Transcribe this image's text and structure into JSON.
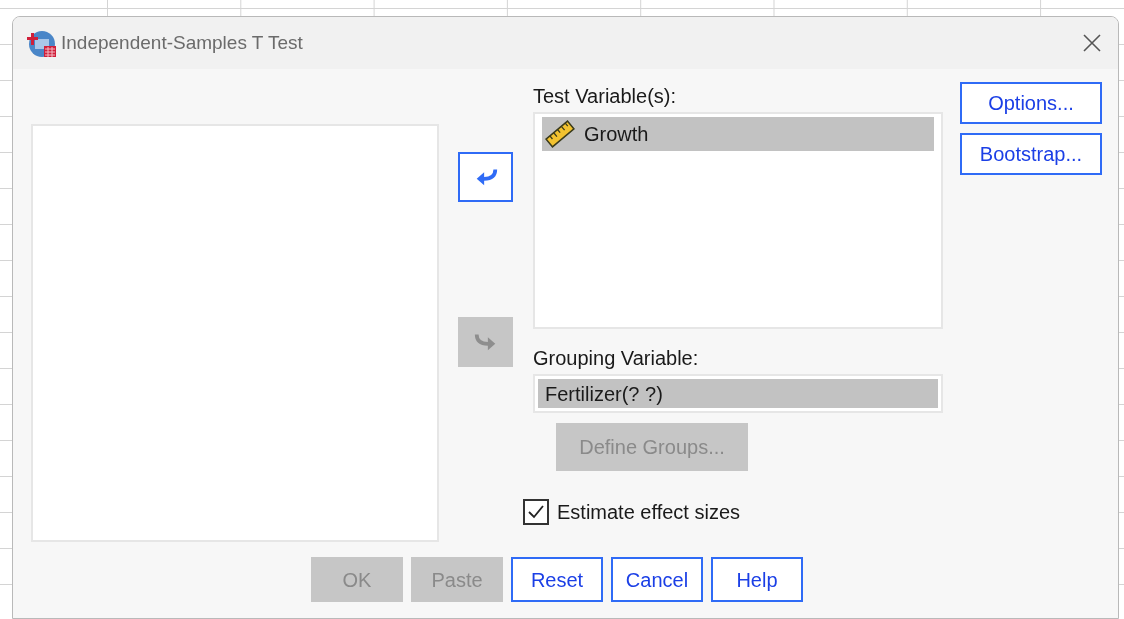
{
  "window": {
    "title": "Independent-Samples T Test"
  },
  "test_move_button": {
    "kind": "back",
    "disabled": false
  },
  "test_variables": {
    "label": "Test Variable(s):",
    "items": [
      {
        "name": "Growth",
        "selected": true
      }
    ]
  },
  "side_buttons": [
    {
      "label": "Options...",
      "disabled": false
    },
    {
      "label": "Bootstrap...",
      "disabled": false
    }
  ],
  "grouping_move_button": {
    "kind": "forward",
    "disabled": true
  },
  "grouping_variable": {
    "label": "Grouping Variable:",
    "value": "Fertilizer(? ?)",
    "selected": true
  },
  "define_groups_button": {
    "label": "Define Groups...",
    "disabled": true
  },
  "estimate_effect_sizes": {
    "label": "Estimate effect sizes",
    "checked": true
  },
  "buttons": [
    {
      "label": "OK",
      "disabled": true
    },
    {
      "label": "Paste",
      "disabled": true
    },
    {
      "label": "Reset",
      "disabled": false
    },
    {
      "label": "Cancel",
      "disabled": false
    },
    {
      "label": "Help",
      "disabled": false
    }
  ]
}
